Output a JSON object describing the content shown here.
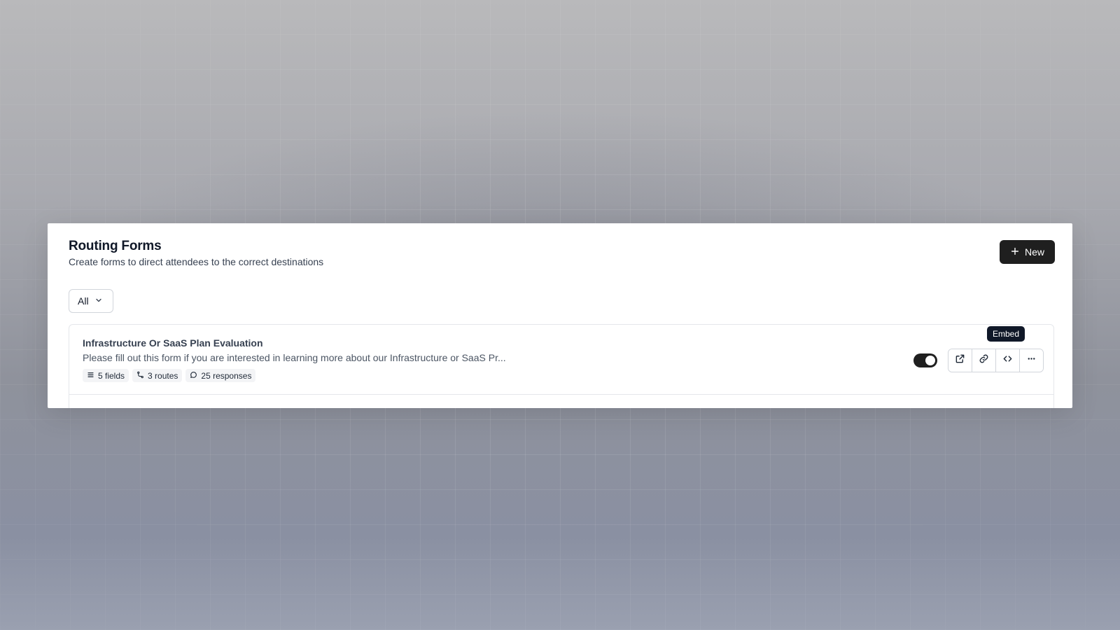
{
  "header": {
    "title": "Routing Forms",
    "subtitle": "Create forms to direct attendees to the correct destinations",
    "new_button_label": "New"
  },
  "filter": {
    "selected": "All"
  },
  "forms": [
    {
      "title": "Infrastructure Or SaaS Plan Evaluation",
      "description": "Please fill out this form if you are interested in learning more about our Infrastructure or SaaS Pr...",
      "badges": {
        "fields": "5 fields",
        "routes": "3 routes",
        "responses": "25 responses"
      },
      "enabled": true,
      "tooltip": "Embed"
    }
  ],
  "icons": {
    "new": "plus-icon",
    "filter": "chevron-down-icon",
    "fields": "list-icon",
    "routes": "route-icon",
    "responses": "message-icon",
    "preview": "external-link-icon",
    "copy_link": "link-icon",
    "embed": "code-icon",
    "more": "more-horizontal-icon"
  },
  "colors": {
    "primary_button": "#1f1f1f",
    "tooltip_bg": "#101828"
  }
}
